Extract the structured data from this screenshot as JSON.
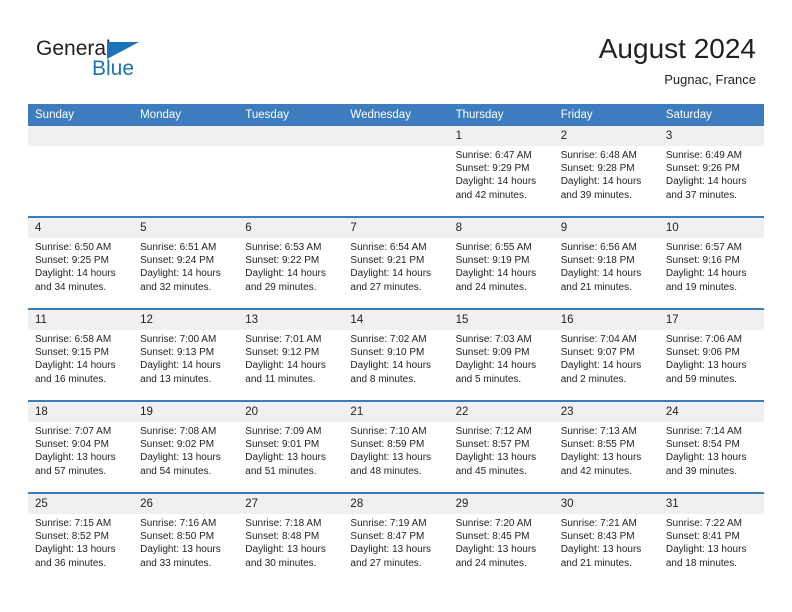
{
  "brand": {
    "name_part1": "General",
    "name_part2": "Blue",
    "triangle_color": "#1a72b8"
  },
  "header": {
    "month_title": "August 2024",
    "location": "Pugnac, France",
    "header_bg_color": "#3d7cbf",
    "daynum_bg_color": "#f0f0f0"
  },
  "weekday_headers": [
    "Sunday",
    "Monday",
    "Tuesday",
    "Wednesday",
    "Thursday",
    "Friday",
    "Saturday"
  ],
  "weeks": [
    [
      {
        "day": "",
        "sunrise": "",
        "sunset": "",
        "daylight1": "",
        "daylight2": "",
        "empty": true
      },
      {
        "day": "",
        "sunrise": "",
        "sunset": "",
        "daylight1": "",
        "daylight2": "",
        "empty": true
      },
      {
        "day": "",
        "sunrise": "",
        "sunset": "",
        "daylight1": "",
        "daylight2": "",
        "empty": true
      },
      {
        "day": "",
        "sunrise": "",
        "sunset": "",
        "daylight1": "",
        "daylight2": "",
        "empty": true
      },
      {
        "day": "1",
        "sunrise": "Sunrise: 6:47 AM",
        "sunset": "Sunset: 9:29 PM",
        "daylight1": "Daylight: 14 hours",
        "daylight2": "and 42 minutes."
      },
      {
        "day": "2",
        "sunrise": "Sunrise: 6:48 AM",
        "sunset": "Sunset: 9:28 PM",
        "daylight1": "Daylight: 14 hours",
        "daylight2": "and 39 minutes."
      },
      {
        "day": "3",
        "sunrise": "Sunrise: 6:49 AM",
        "sunset": "Sunset: 9:26 PM",
        "daylight1": "Daylight: 14 hours",
        "daylight2": "and 37 minutes."
      }
    ],
    [
      {
        "day": "4",
        "sunrise": "Sunrise: 6:50 AM",
        "sunset": "Sunset: 9:25 PM",
        "daylight1": "Daylight: 14 hours",
        "daylight2": "and 34 minutes."
      },
      {
        "day": "5",
        "sunrise": "Sunrise: 6:51 AM",
        "sunset": "Sunset: 9:24 PM",
        "daylight1": "Daylight: 14 hours",
        "daylight2": "and 32 minutes."
      },
      {
        "day": "6",
        "sunrise": "Sunrise: 6:53 AM",
        "sunset": "Sunset: 9:22 PM",
        "daylight1": "Daylight: 14 hours",
        "daylight2": "and 29 minutes."
      },
      {
        "day": "7",
        "sunrise": "Sunrise: 6:54 AM",
        "sunset": "Sunset: 9:21 PM",
        "daylight1": "Daylight: 14 hours",
        "daylight2": "and 27 minutes."
      },
      {
        "day": "8",
        "sunrise": "Sunrise: 6:55 AM",
        "sunset": "Sunset: 9:19 PM",
        "daylight1": "Daylight: 14 hours",
        "daylight2": "and 24 minutes."
      },
      {
        "day": "9",
        "sunrise": "Sunrise: 6:56 AM",
        "sunset": "Sunset: 9:18 PM",
        "daylight1": "Daylight: 14 hours",
        "daylight2": "and 21 minutes."
      },
      {
        "day": "10",
        "sunrise": "Sunrise: 6:57 AM",
        "sunset": "Sunset: 9:16 PM",
        "daylight1": "Daylight: 14 hours",
        "daylight2": "and 19 minutes."
      }
    ],
    [
      {
        "day": "11",
        "sunrise": "Sunrise: 6:58 AM",
        "sunset": "Sunset: 9:15 PM",
        "daylight1": "Daylight: 14 hours",
        "daylight2": "and 16 minutes."
      },
      {
        "day": "12",
        "sunrise": "Sunrise: 7:00 AM",
        "sunset": "Sunset: 9:13 PM",
        "daylight1": "Daylight: 14 hours",
        "daylight2": "and 13 minutes."
      },
      {
        "day": "13",
        "sunrise": "Sunrise: 7:01 AM",
        "sunset": "Sunset: 9:12 PM",
        "daylight1": "Daylight: 14 hours",
        "daylight2": "and 11 minutes."
      },
      {
        "day": "14",
        "sunrise": "Sunrise: 7:02 AM",
        "sunset": "Sunset: 9:10 PM",
        "daylight1": "Daylight: 14 hours",
        "daylight2": "and 8 minutes."
      },
      {
        "day": "15",
        "sunrise": "Sunrise: 7:03 AM",
        "sunset": "Sunset: 9:09 PM",
        "daylight1": "Daylight: 14 hours",
        "daylight2": "and 5 minutes."
      },
      {
        "day": "16",
        "sunrise": "Sunrise: 7:04 AM",
        "sunset": "Sunset: 9:07 PM",
        "daylight1": "Daylight: 14 hours",
        "daylight2": "and 2 minutes."
      },
      {
        "day": "17",
        "sunrise": "Sunrise: 7:06 AM",
        "sunset": "Sunset: 9:06 PM",
        "daylight1": "Daylight: 13 hours",
        "daylight2": "and 59 minutes."
      }
    ],
    [
      {
        "day": "18",
        "sunrise": "Sunrise: 7:07 AM",
        "sunset": "Sunset: 9:04 PM",
        "daylight1": "Daylight: 13 hours",
        "daylight2": "and 57 minutes."
      },
      {
        "day": "19",
        "sunrise": "Sunrise: 7:08 AM",
        "sunset": "Sunset: 9:02 PM",
        "daylight1": "Daylight: 13 hours",
        "daylight2": "and 54 minutes."
      },
      {
        "day": "20",
        "sunrise": "Sunrise: 7:09 AM",
        "sunset": "Sunset: 9:01 PM",
        "daylight1": "Daylight: 13 hours",
        "daylight2": "and 51 minutes."
      },
      {
        "day": "21",
        "sunrise": "Sunrise: 7:10 AM",
        "sunset": "Sunset: 8:59 PM",
        "daylight1": "Daylight: 13 hours",
        "daylight2": "and 48 minutes."
      },
      {
        "day": "22",
        "sunrise": "Sunrise: 7:12 AM",
        "sunset": "Sunset: 8:57 PM",
        "daylight1": "Daylight: 13 hours",
        "daylight2": "and 45 minutes."
      },
      {
        "day": "23",
        "sunrise": "Sunrise: 7:13 AM",
        "sunset": "Sunset: 8:55 PM",
        "daylight1": "Daylight: 13 hours",
        "daylight2": "and 42 minutes."
      },
      {
        "day": "24",
        "sunrise": "Sunrise: 7:14 AM",
        "sunset": "Sunset: 8:54 PM",
        "daylight1": "Daylight: 13 hours",
        "daylight2": "and 39 minutes."
      }
    ],
    [
      {
        "day": "25",
        "sunrise": "Sunrise: 7:15 AM",
        "sunset": "Sunset: 8:52 PM",
        "daylight1": "Daylight: 13 hours",
        "daylight2": "and 36 minutes."
      },
      {
        "day": "26",
        "sunrise": "Sunrise: 7:16 AM",
        "sunset": "Sunset: 8:50 PM",
        "daylight1": "Daylight: 13 hours",
        "daylight2": "and 33 minutes."
      },
      {
        "day": "27",
        "sunrise": "Sunrise: 7:18 AM",
        "sunset": "Sunset: 8:48 PM",
        "daylight1": "Daylight: 13 hours",
        "daylight2": "and 30 minutes."
      },
      {
        "day": "28",
        "sunrise": "Sunrise: 7:19 AM",
        "sunset": "Sunset: 8:47 PM",
        "daylight1": "Daylight: 13 hours",
        "daylight2": "and 27 minutes."
      },
      {
        "day": "29",
        "sunrise": "Sunrise: 7:20 AM",
        "sunset": "Sunset: 8:45 PM",
        "daylight1": "Daylight: 13 hours",
        "daylight2": "and 24 minutes."
      },
      {
        "day": "30",
        "sunrise": "Sunrise: 7:21 AM",
        "sunset": "Sunset: 8:43 PM",
        "daylight1": "Daylight: 13 hours",
        "daylight2": "and 21 minutes."
      },
      {
        "day": "31",
        "sunrise": "Sunrise: 7:22 AM",
        "sunset": "Sunset: 8:41 PM",
        "daylight1": "Daylight: 13 hours",
        "daylight2": "and 18 minutes."
      }
    ]
  ]
}
